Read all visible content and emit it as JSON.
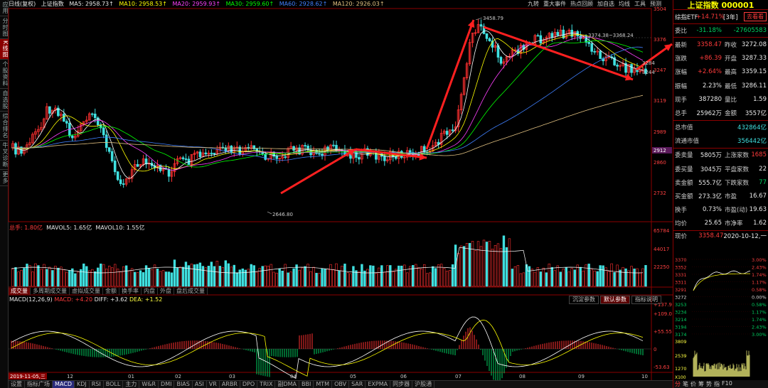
{
  "left_tabs": [
    "应用",
    "分时图",
    "K线图",
    "个股资料",
    "自选股",
    "综合排名",
    "牛叉诊断",
    "更多"
  ],
  "left_tab_active": 2,
  "header": {
    "period": "日线(复权)",
    "name": "上证指数",
    "ma5": "MA5: 2958.73↑",
    "ma10": "MA10: 2958.53↑",
    "ma20": "MA20: 2959.93↑",
    "ma30": "MA30: 2959.60↑",
    "ma60": "MA60: 2928.62↑",
    "ma120": "MA120: 2926.03↑"
  },
  "top_icons": [
    "九转",
    "重大事件",
    "热点回顾",
    "加自选",
    "均线",
    "工具",
    "预测"
  ],
  "price_axis": [
    "3504",
    "3376",
    "3247",
    "3119",
    "2989",
    "2860",
    "2732"
  ],
  "price_axis_highlight": "2912",
  "annotations": {
    "high": "3458.79",
    "low": "2646.80",
    "mid": "3374.38~3368.24",
    "right1": "3284",
    "right2": "3244"
  },
  "volume": {
    "label": "总手: 1.80亿",
    "mavol5": "MAVOL5: 1.65亿",
    "mavol10": "MAVOL10: 1.55亿",
    "axis": [
      "65784",
      "44017",
      "22250"
    ]
  },
  "volume_tabs": [
    "成交量",
    "多周期成交量",
    "虚拟成交量",
    "金额",
    "换手率",
    "内盘",
    "外盘",
    "盘后成交量"
  ],
  "macd": {
    "label": "MACD(12,26,9)",
    "macd": "MACD: +4.20",
    "diff": "DIFF: +3.62",
    "dea": "DEA: +1.52",
    "axis": [
      "+137.9",
      "+109.0",
      "+55.55",
      "0",
      "-53.63"
    ],
    "buttons": [
      "沉淀参数",
      "默认参数",
      "指标说明"
    ],
    "button_active": 1
  },
  "x_axis": [
    "2019-11-05,三",
    "12",
    "01",
    "02",
    "03",
    "04",
    "05",
    "06",
    "07",
    "08",
    "09",
    "10"
  ],
  "bottom_tabs": [
    "设置",
    "指标广场",
    "MACD",
    "KDJ",
    "RSI",
    "BOLL",
    "主力",
    "W&R",
    "DMI",
    "BIAS",
    "ASI",
    "VR",
    "ARBR",
    "DPO",
    "TRIX",
    "副DMA",
    "BBI",
    "MTM",
    "OBV",
    "SAR",
    "EXPMA",
    "同步器",
    "沪股通"
  ],
  "bottom_tab_active": 2,
  "right_panel": {
    "title": "上证指数 000001",
    "etf_label": "综指ETF",
    "etf_value": "+14.71%",
    "etf_extra": "[3年]",
    "etf_button": "去看看",
    "weibi_label": "委比",
    "weibi_value": "-31.18%",
    "weibi_value2": "-27605583",
    "rows1": [
      {
        "l1": "最新",
        "v1": "3358.47",
        "l2": "昨收",
        "v2": "3272.08"
      },
      {
        "l1": "涨跌",
        "v1": "+86.39",
        "l2": "开盘",
        "v2": "3287.33"
      },
      {
        "l1": "涨幅",
        "v1": "+2.64%",
        "l2": "最高",
        "v2": "3359.15"
      },
      {
        "l1": "振幅",
        "v1": "2.23%",
        "l2": "最低",
        "v2": "3286.11"
      },
      {
        "l1": "现手",
        "v1": "387280",
        "l2": "量比",
        "v2": "1.59"
      },
      {
        "l1": "总手",
        "v1": "25962万",
        "l2": "金额",
        "v2": "3557亿"
      }
    ],
    "rows2": [
      {
        "l1": "总市值",
        "v2": "432864亿"
      },
      {
        "l1": "流通市值",
        "v2": "356442亿"
      }
    ],
    "rows3": [
      {
        "l1": "委卖量",
        "v1": "5805万",
        "l2": "上涨家数",
        "v2": "1685"
      },
      {
        "l1": "委买量",
        "v1": "3045万",
        "l2": "平盘家数",
        "v2": "22"
      },
      {
        "l1": "卖金额",
        "v1": "555.7亿",
        "l2": "下跌家数",
        "v2": "77"
      },
      {
        "l1": "买金额",
        "v1": "273.3亿",
        "l2": "市盈",
        "v2": "16.67"
      },
      {
        "l1": "换手",
        "v1": "0.73%",
        "l2": "市盈(动)",
        "v2": "19.63"
      },
      {
        "l1": "均价",
        "v1": "25.65",
        "l2": "市净率",
        "v2": "1.62"
      }
    ],
    "quote_label": "现价",
    "quote_value": "3358.47",
    "quote_date": "2020-10-12,一",
    "mini_left": [
      "3370",
      "3352",
      "3331",
      "3311",
      "3291",
      "3272",
      "3253",
      "3234",
      "3214",
      "3194",
      "3174"
    ],
    "mini_right": [
      "3.00%",
      "2.43%",
      "1.74%",
      "1.17%",
      "0.58%",
      "0.00%",
      "0.58%",
      "1.17%",
      "1.74%",
      "2.43%",
      "3.00%"
    ],
    "mini_vol": [
      "3809",
      "2539",
      "1270"
    ],
    "mini_vol_unit": "X100",
    "bottom_tabs": [
      "分",
      "笔",
      "价",
      "筹",
      "势",
      "指",
      "F10"
    ]
  }
}
